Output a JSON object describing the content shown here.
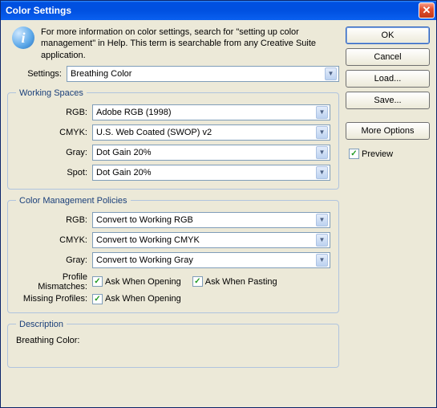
{
  "window": {
    "title": "Color Settings"
  },
  "info": {
    "icon_glyph": "i",
    "text": "For more information on color settings, search for \"setting up color management\" in Help. This term is searchable from any Creative Suite application."
  },
  "settings": {
    "label": "Settings:",
    "value": "Breathing Color"
  },
  "working_spaces": {
    "legend": "Working Spaces",
    "rgb_label": "RGB:",
    "rgb_value": "Adobe RGB (1998)",
    "cmyk_label": "CMYK:",
    "cmyk_value": "U.S. Web Coated (SWOP) v2",
    "gray_label": "Gray:",
    "gray_value": "Dot Gain 20%",
    "spot_label": "Spot:",
    "spot_value": "Dot Gain 20%"
  },
  "policies": {
    "legend": "Color Management Policies",
    "rgb_label": "RGB:",
    "rgb_value": "Convert to Working RGB",
    "cmyk_label": "CMYK:",
    "cmyk_value": "Convert to Working CMYK",
    "gray_label": "Gray:",
    "gray_value": "Convert to Working Gray",
    "mismatch_label": "Profile Mismatches:",
    "mismatch_open": "Ask When Opening",
    "mismatch_paste": "Ask When Pasting",
    "missing_label": "Missing Profiles:",
    "missing_open": "Ask When Opening"
  },
  "description": {
    "legend": "Description",
    "text": "Breathing Color:"
  },
  "buttons": {
    "ok": "OK",
    "cancel": "Cancel",
    "load": "Load...",
    "save": "Save...",
    "more": "More Options",
    "preview": "Preview"
  },
  "glyphs": {
    "check": "✓",
    "down": "▼",
    "close": "✕"
  }
}
